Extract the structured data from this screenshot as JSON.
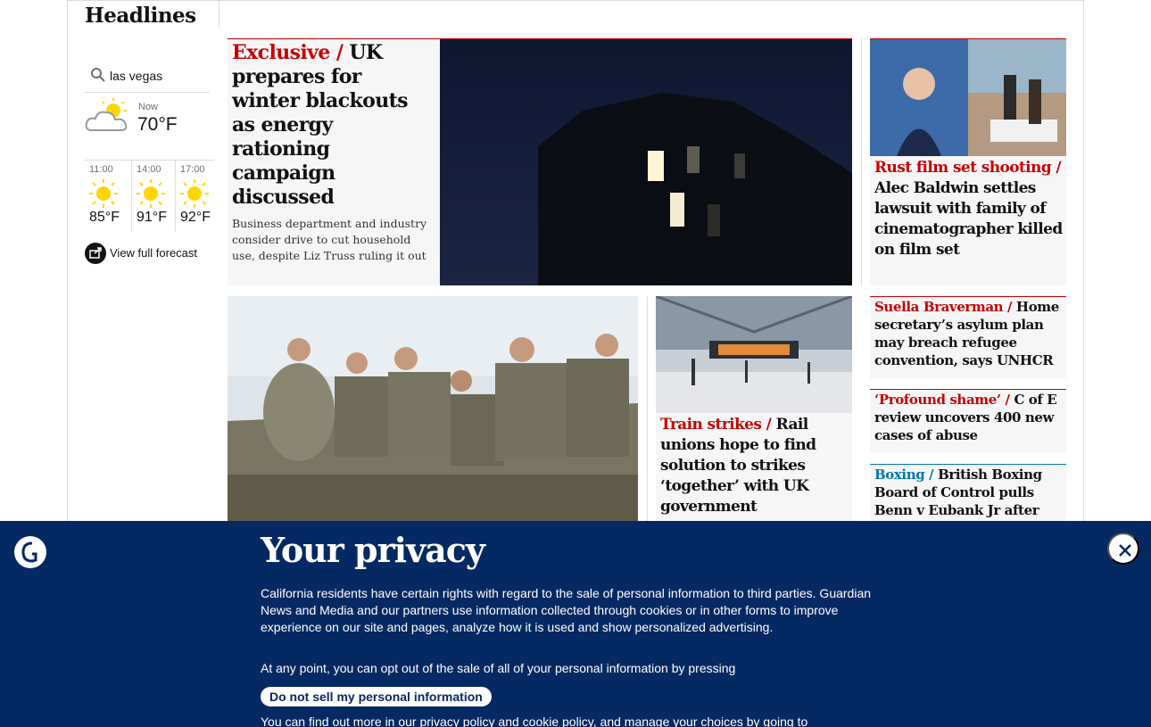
{
  "section": {
    "title": "Headlines"
  },
  "weather": {
    "search_value": "las vegas",
    "now_label": "Now",
    "now_temp": "70°F",
    "hours": [
      {
        "time": "11:00",
        "temp": "85°F",
        "icon": "sun-icon"
      },
      {
        "time": "14:00",
        "temp": "91°F",
        "icon": "sun-icon"
      },
      {
        "time": "17:00",
        "temp": "92°F",
        "icon": "sun-icon"
      }
    ],
    "forecast_link": "View full forecast"
  },
  "stories": {
    "main": {
      "kicker": "Exclusive",
      "headline": "UK prepares for winter blackouts as energy rationing campaign discussed",
      "standfirst": "Business department and industry consider drive to cut household use, despite Liz Truss ruling it out"
    },
    "rust": {
      "kicker": "Rust film set shooting",
      "headline": "Alec Baldwin settles lawsuit with family of cinematographer killed on film set"
    },
    "braverman": {
      "kicker": "Suella Braverman",
      "headline": "Home secretary’s asylum plan may breach refugee convention, says UNHCR"
    },
    "cofe": {
      "kicker": "‘Profound shame’",
      "headline": "C of E review uncovers 400 new cases of abuse"
    },
    "boxing": {
      "kicker": "Boxing",
      "headline": "British Boxing Board of Control pulls Benn v Eubank Jr after"
    },
    "train": {
      "kicker": "Train strikes",
      "headline": "Rail unions hope to find solution to strikes ‘together’ with UK government"
    }
  },
  "privacy": {
    "title": "Your privacy",
    "body": "California residents have certain rights with regard to the sale of personal information to third parties. Guardian News and Media and our partners use information collected through cookies or in other forms to improve experience on our site and pages, analyze how it is used and show personalized advertising.",
    "optout_text": "At any point, you can opt out of the sale of all of your personal information by pressing",
    "button_label": "Do not sell my personal information",
    "more_text": "You can find out more in our privacy policy and cookie policy, and manage your choices by going to"
  },
  "colors": {
    "news_red": "#c70000",
    "sport_blue": "#0077b6",
    "privacy_bg": "#052962"
  }
}
